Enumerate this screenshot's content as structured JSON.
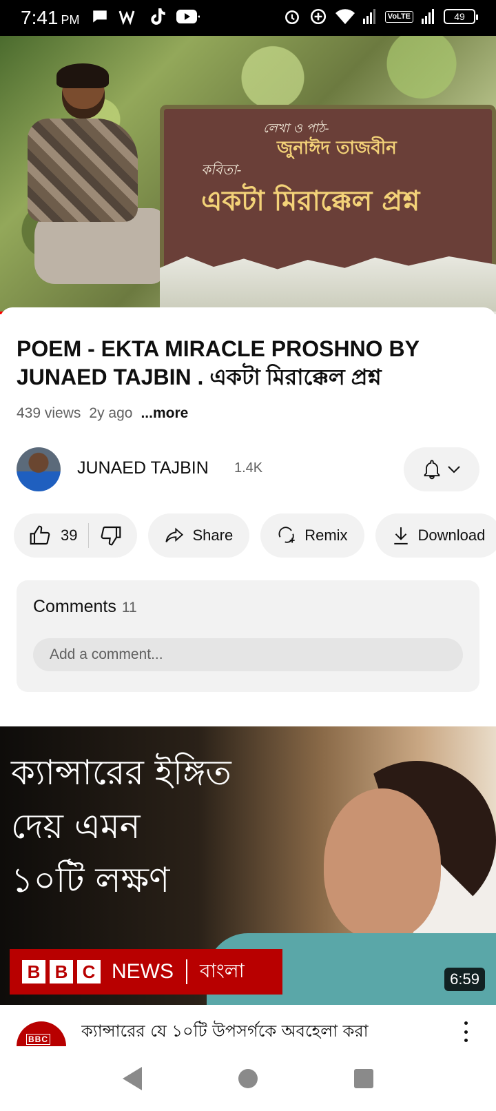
{
  "status_bar": {
    "time": "7:41",
    "ampm": "PM",
    "volte": "VoLTE",
    "battery": "49"
  },
  "player": {
    "board_line1": "লেখা ও পাঠ-",
    "board_line2": "জুনাঈদ তাজবীন",
    "board_line3": "কবিতা-",
    "board_title": "একটা মিরাক্কেল প্রশ্ন",
    "progress_fraction": 0.06
  },
  "video": {
    "title": "POEM - EKTA MIRACLE PROSHNO BY JUNAED TAJBIN . একটা মিরাক্কেল প্রশ্ন",
    "views": "439 views",
    "age": "2y ago",
    "more": "...more"
  },
  "channel": {
    "name": "JUNAED TAJBIN",
    "subscribers": "1.4K"
  },
  "actions": {
    "likes": "39",
    "share": "Share",
    "remix": "Remix",
    "download": "Download"
  },
  "comments": {
    "label": "Comments",
    "count": "11",
    "placeholder": "Add a comment..."
  },
  "next_video": {
    "thumb_line1": "ক্যান্সারের ইঙ্গিত",
    "thumb_line2": "দেয় এমন",
    "thumb_line3": "১০টি লক্ষণ",
    "banner_b1": "B",
    "banner_b2": "B",
    "banner_c": "C",
    "banner_news": "NEWS",
    "banner_bangla": "বাংলা",
    "duration": "6:59",
    "channel_logo": "BBC",
    "title": "ক্যান্সারের যে ১০টি উপসর্গকে অবহেলা করা"
  }
}
